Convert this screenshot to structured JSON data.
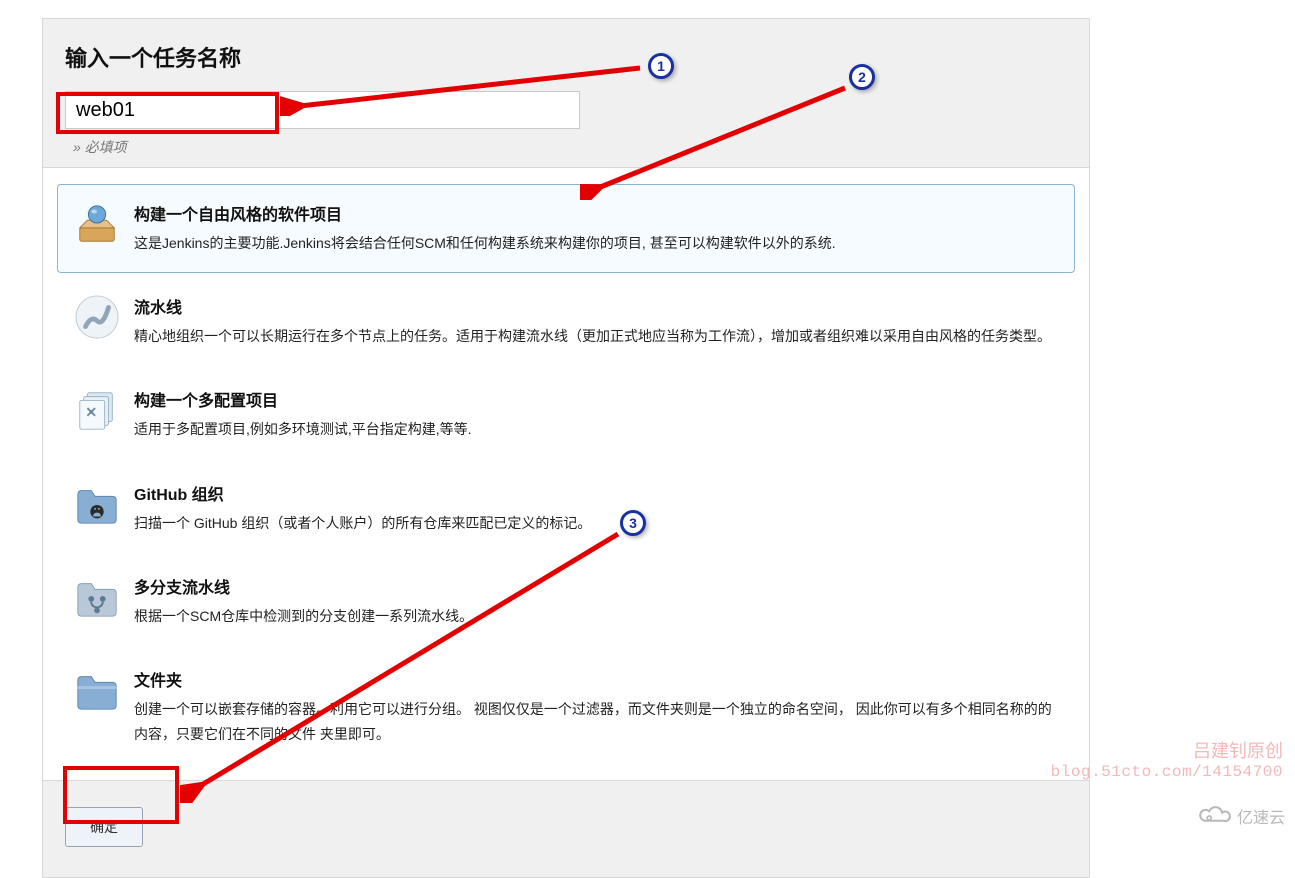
{
  "title": "输入一个任务名称",
  "task_name_value": "web01",
  "required_hint": "» 必填项",
  "options": {
    "freestyle": {
      "name": "构建一个自由风格的软件项目",
      "desc": "这是Jenkins的主要功能.Jenkins将会结合任何SCM和任何构建系统来构建你的项目, 甚至可以构建软件以外的系统."
    },
    "pipeline": {
      "name": "流水线",
      "desc": "精心地组织一个可以长期运行在多个节点上的任务。适用于构建流水线（更加正式地应当称为工作流），增加或者组织难以采用自由风格的任务类型。"
    },
    "multiconfig": {
      "name": "构建一个多配置项目",
      "desc": "适用于多配置项目,例如多环境测试,平台指定构建,等等."
    },
    "github_org": {
      "name": "GitHub 组织",
      "desc": "扫描一个 GitHub 组织（或者个人账户）的所有仓库来匹配已定义的标记。"
    },
    "multibranch": {
      "name": "多分支流水线",
      "desc": "根据一个SCM仓库中检测到的分支创建一系列流水线。"
    },
    "folder": {
      "name": "文件夹",
      "desc": "创建一个可以嵌套存储的容器。利用它可以进行分组。 视图仅仅是一个过滤器，而文件夹则是一个独立的命名空间， 因此你可以有多个相同名称的的内容，只要它们在不同的文件 夹里即可。"
    }
  },
  "ok_label": "确定",
  "annotations": {
    "b1": "1",
    "b2": "2",
    "b3": "3"
  },
  "watermark": {
    "author": "吕建钊原创",
    "url": "blog.51cto.com/14154700",
    "site": "亿速云"
  }
}
